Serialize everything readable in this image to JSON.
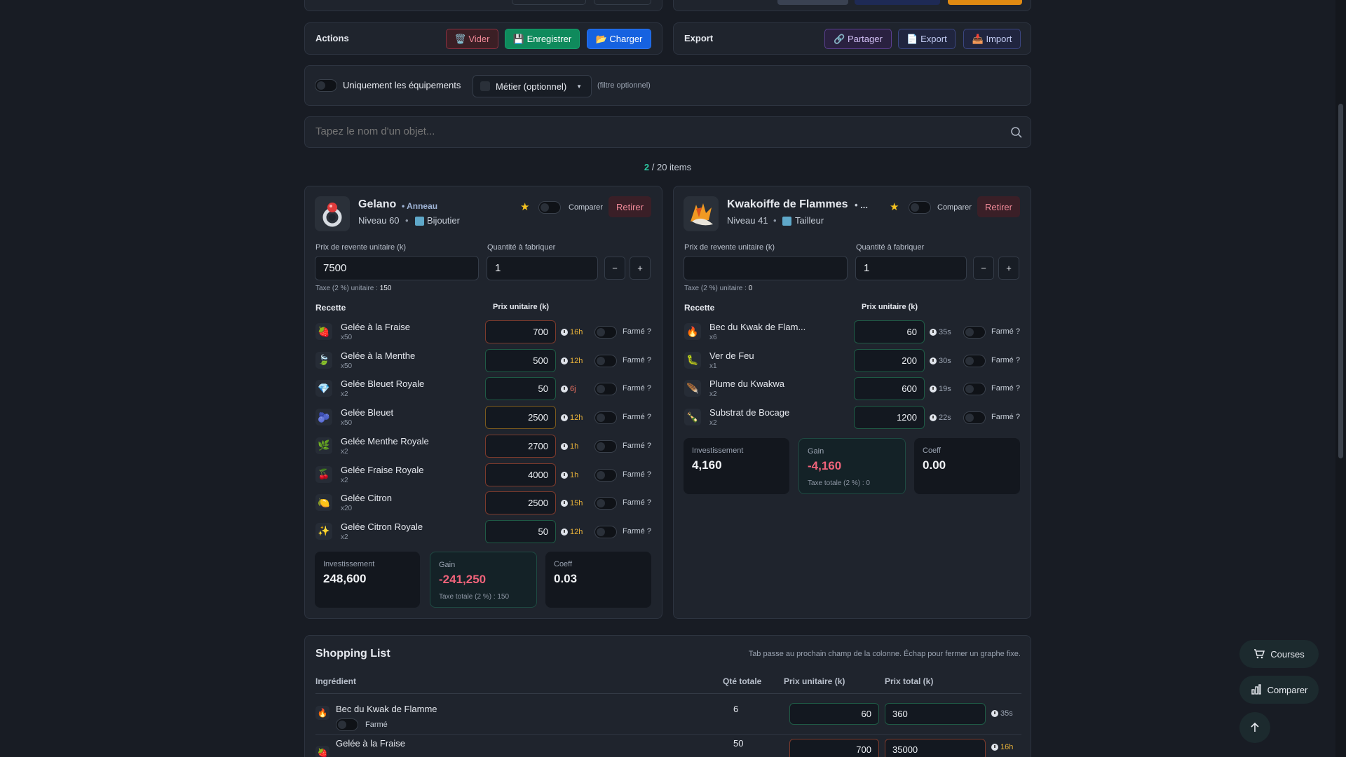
{
  "actions": {
    "title": "Actions",
    "vider": "🗑️ Vider",
    "enregistrer": "💾 Enregistrer",
    "charger": "📂 Charger"
  },
  "export": {
    "title": "Export",
    "partager": "🔗 Partager",
    "export": "📄 Export",
    "import": "📥 Import"
  },
  "filters": {
    "equip_label": "Uniquement les équipements",
    "metier_select": "Métier (optionnel)",
    "metier_hint": "(filtre optionnel)"
  },
  "search": {
    "placeholder": "Tapez le nom d'un objet..."
  },
  "count": {
    "current": "2",
    "total": "/ 20 items"
  },
  "labels": {
    "compare": "Comparer",
    "remove": "Retirer",
    "resale": "Prix de revente unitaire (k)",
    "qty": "Quantité à fabriquer",
    "recipe": "Recette",
    "unit_price": "Prix unitaire (k)",
    "farmed": "Farmé ?",
    "minus": "−",
    "plus": "+",
    "invest": "Investissement",
    "gain": "Gain",
    "coeff": "Coeff",
    "star": "★"
  },
  "cards": [
    {
      "name": "Gelano",
      "type": "• Anneau",
      "level": "Niveau 60",
      "job": "Bijoutier",
      "bullet": "•",
      "resale_value": "7500",
      "qty_value": "1",
      "tax": "Taxe (2 %) unitaire : ",
      "tax_value": "150",
      "ingredients": [
        {
          "name": "Gelée à la Fraise",
          "qty": "x50",
          "price": "700",
          "time": "16h",
          "tcolor": "gold",
          "border": "red",
          "icon": "🍓"
        },
        {
          "name": "Gelée à la Menthe",
          "qty": "x50",
          "price": "500",
          "time": "12h",
          "tcolor": "gold",
          "border": "green",
          "icon": "🍃"
        },
        {
          "name": "Gelée Bleuet Royale",
          "qty": "x2",
          "price": "50",
          "time": "6j",
          "tcolor": "red",
          "border": "green",
          "icon": "💎"
        },
        {
          "name": "Gelée Bleuet",
          "qty": "x50",
          "price": "2500",
          "time": "12h",
          "tcolor": "gold",
          "border": "gold",
          "icon": "🫐"
        },
        {
          "name": "Gelée Menthe Royale",
          "qty": "x2",
          "price": "2700",
          "time": "1h",
          "tcolor": "gold",
          "border": "red",
          "icon": "🌿"
        },
        {
          "name": "Gelée Fraise Royale",
          "qty": "x2",
          "price": "4000",
          "time": "1h",
          "tcolor": "gold",
          "border": "red",
          "icon": "🍒"
        },
        {
          "name": "Gelée Citron",
          "qty": "x20",
          "price": "2500",
          "time": "15h",
          "tcolor": "gold",
          "border": "red",
          "icon": "🍋"
        },
        {
          "name": "Gelée Citron Royale",
          "qty": "x2",
          "price": "50",
          "time": "12h",
          "tcolor": "gold",
          "border": "green",
          "icon": "✨"
        }
      ],
      "invest": "248,600",
      "gain": "-241,250",
      "gain_tax": "Taxe totale (2 %) : 150",
      "coeff": "0.03"
    },
    {
      "name": "Kwakoiffe de Flammes",
      "type": "• ...",
      "level": "Niveau 41",
      "job": "Tailleur",
      "bullet": "•",
      "resale_value": "",
      "qty_value": "1",
      "tax": "Taxe (2 %) unitaire : ",
      "tax_value": "0",
      "ingredients": [
        {
          "name": "Bec du Kwak de Flam...",
          "qty": "x6",
          "price": "60",
          "time": "35s",
          "tcolor": "grey",
          "border": "green",
          "icon": "🔥"
        },
        {
          "name": "Ver de Feu",
          "qty": "x1",
          "price": "200",
          "time": "30s",
          "tcolor": "grey",
          "border": "green",
          "icon": "🐛"
        },
        {
          "name": "Plume du Kwakwa",
          "qty": "x2",
          "price": "600",
          "time": "19s",
          "tcolor": "grey",
          "border": "green",
          "icon": "🪶"
        },
        {
          "name": "Substrat de Bocage",
          "qty": "x2",
          "price": "1200",
          "time": "22s",
          "tcolor": "grey",
          "border": "green",
          "icon": "🍾"
        }
      ],
      "invest": "4,160",
      "gain": "-4,160",
      "gain_tax": "Taxe totale (2 %) : 0",
      "coeff": "0.00"
    }
  ],
  "shopping": {
    "title": "Shopping List",
    "hint": "Tab passe au prochain champ de la colonne. Échap pour fermer un graphe fixe.",
    "cols": [
      "Ingrédient",
      "Qté totale",
      "Prix unitaire (k)",
      "Prix total (k)"
    ],
    "farmed": "Farmé",
    "rows": [
      {
        "name": "Bec du Kwak de Flamme",
        "qty": "6",
        "unit": "60",
        "total": "360",
        "time": "35s",
        "tcolor": "grey",
        "icon": "🔥"
      },
      {
        "name": "Gelée à la Fraise",
        "qty": "50",
        "unit": "700",
        "total": "35000",
        "time": "16h",
        "tcolor": "gold",
        "icon": "🍓"
      }
    ]
  },
  "fabs": {
    "courses": "Courses",
    "comparer": "Comparer"
  }
}
